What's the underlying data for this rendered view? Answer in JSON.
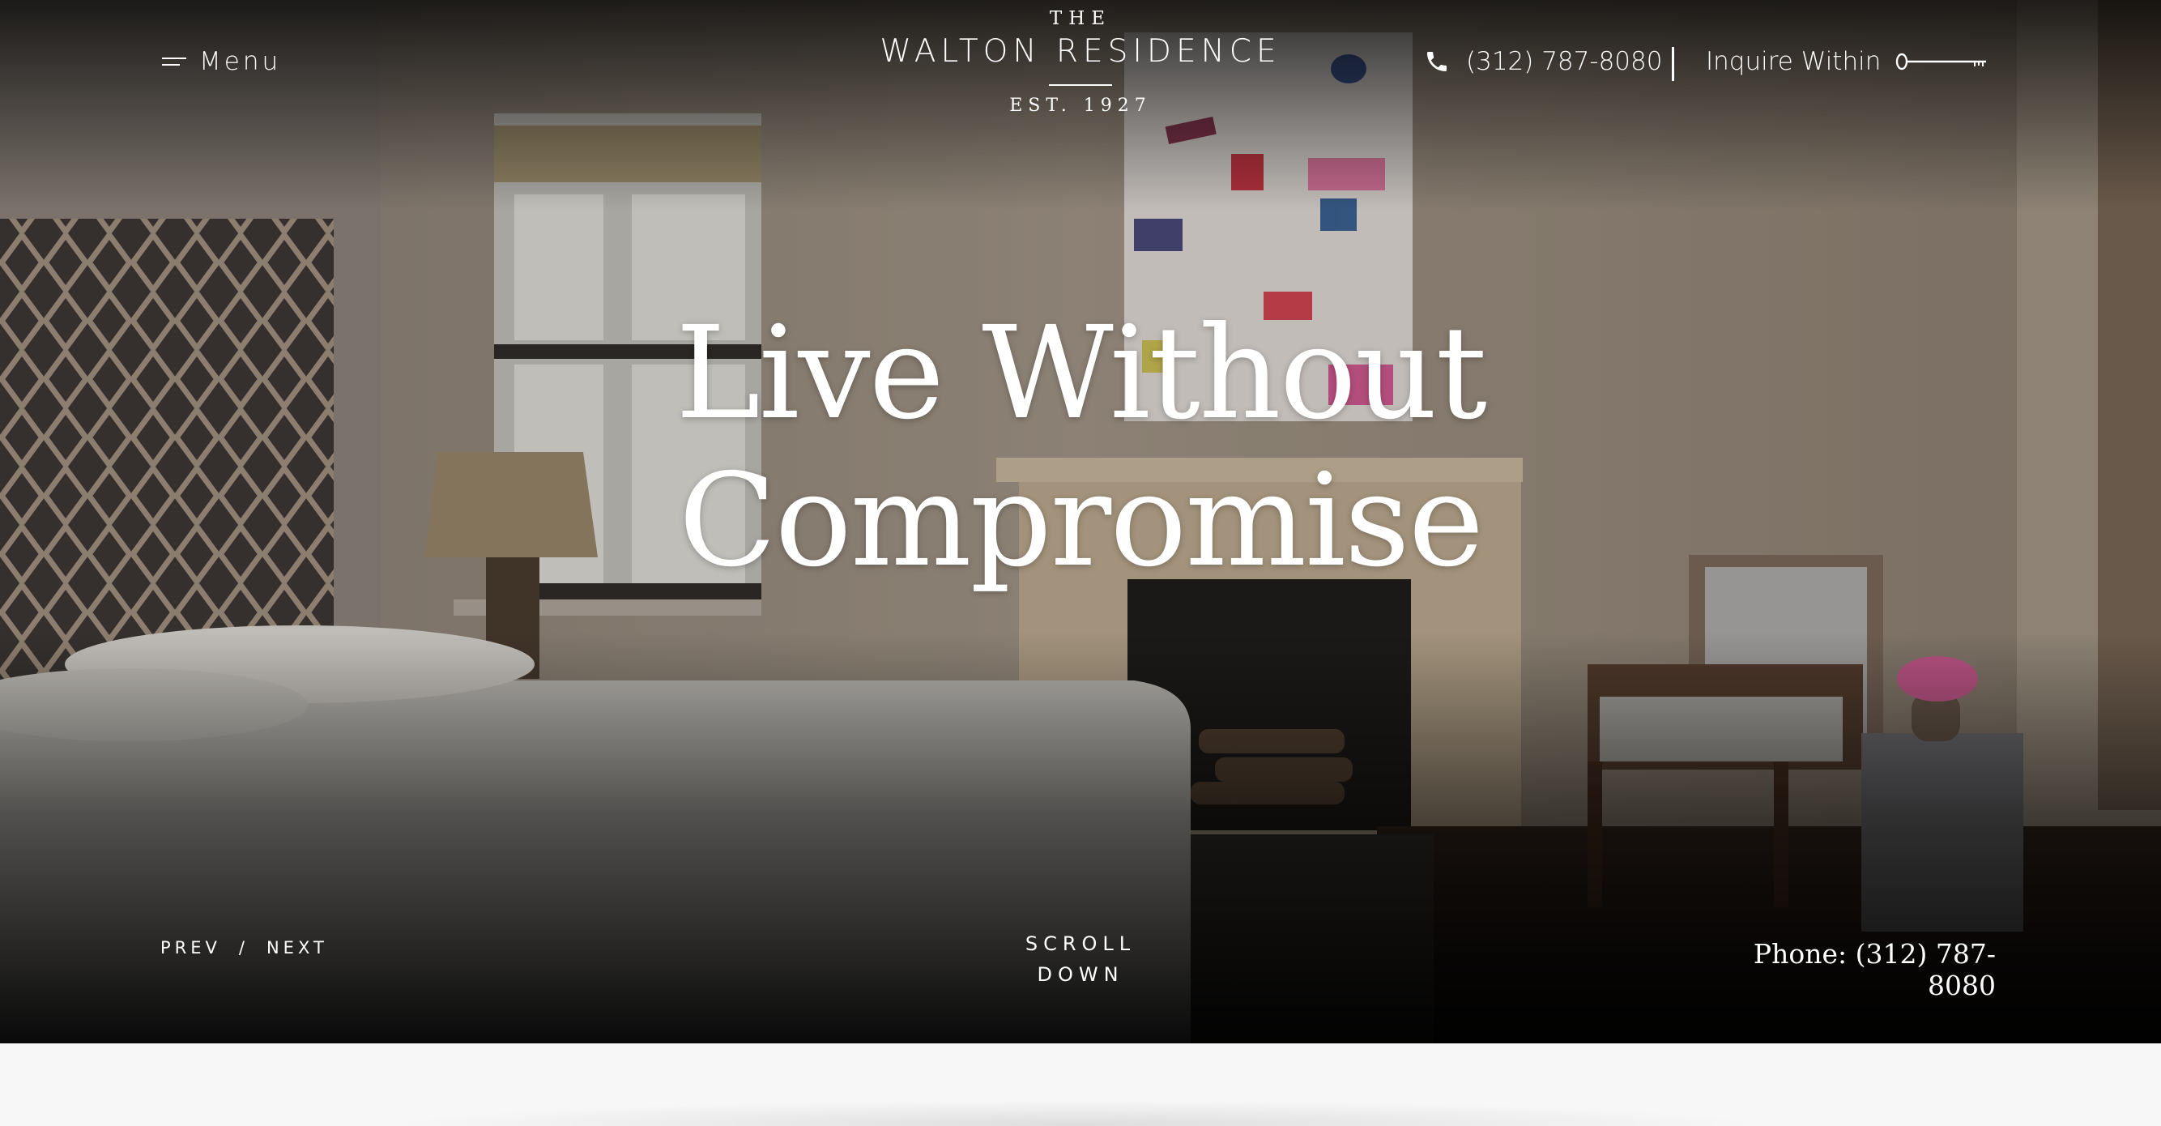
{
  "header": {
    "menu_label": "Menu",
    "logo": {
      "top": "THE",
      "name": "WALTON RESIDENCE",
      "est": "EST. 1927"
    },
    "phone": "(312) 787-8080",
    "inquire_label": "Inquire Within"
  },
  "hero": {
    "headline_line1": "Live Without",
    "headline_line2": "Compromise"
  },
  "slider": {
    "prev_label": "PREV",
    "separator": "/",
    "next_label": "NEXT"
  },
  "scroll": {
    "line1": "SCROLL",
    "line2": "DOWN"
  },
  "footer_phone": "Phone: (312) 787-8080",
  "icons": [
    "menu-icon",
    "phone-icon",
    "key-icon"
  ],
  "colors": {
    "text": "#ffffff",
    "below_background": "#f7f7f7"
  }
}
